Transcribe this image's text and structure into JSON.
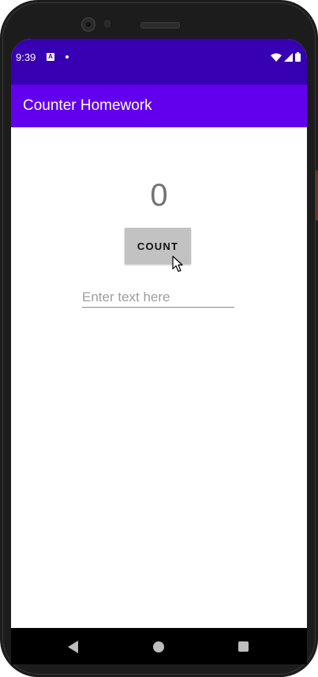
{
  "status_bar": {
    "time": "9:39",
    "notification_icon": "A",
    "icons": [
      "notification-app-icon",
      "dot-icon",
      "wifi-icon",
      "signal-icon",
      "battery-icon"
    ],
    "color": "#3700b3"
  },
  "app_bar": {
    "title": "Counter Homework",
    "color": "#6200ee"
  },
  "counter": {
    "value": "0"
  },
  "count_button": {
    "label": "COUNT",
    "color": "#c2c2c2"
  },
  "text_field": {
    "value": "",
    "placeholder": "Enter text here"
  },
  "nav_bar": {
    "icons": [
      "back-icon",
      "home-icon",
      "recents-icon"
    ]
  }
}
